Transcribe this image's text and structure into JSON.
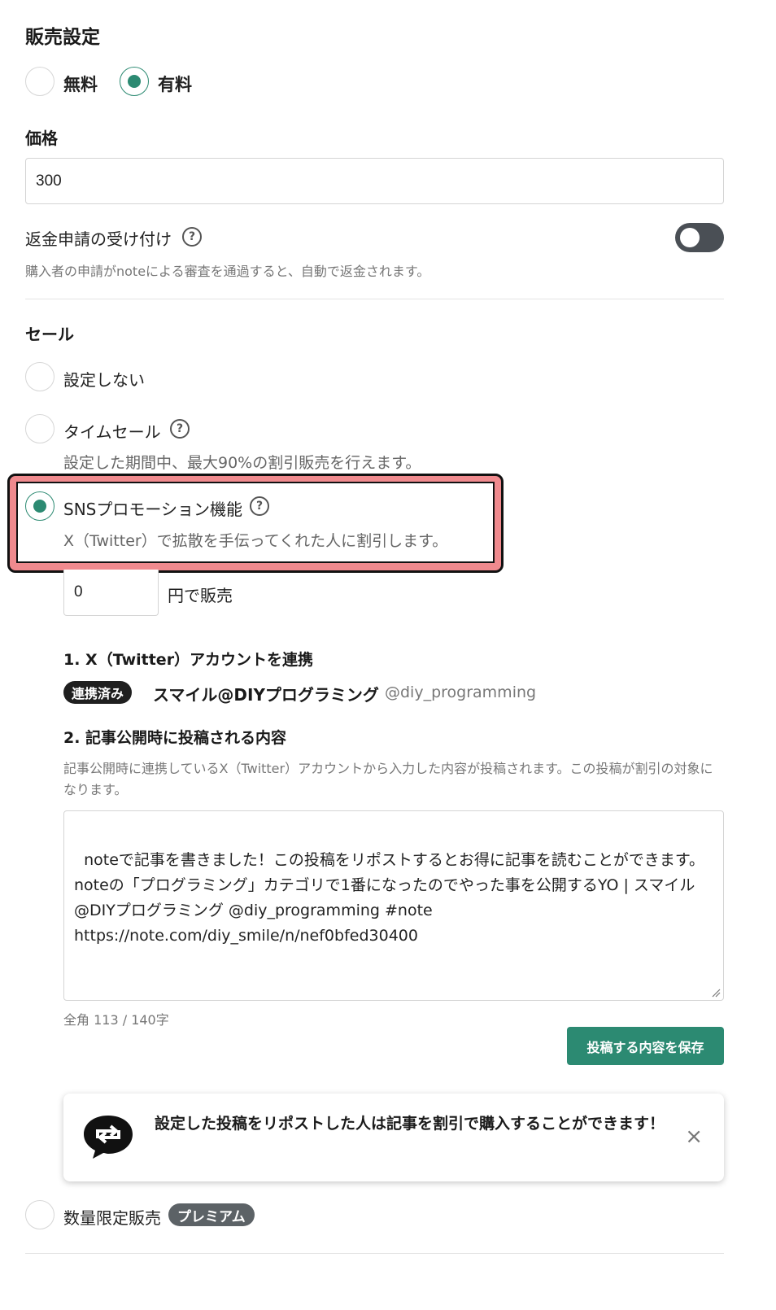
{
  "sales": {
    "title": "販売設定",
    "options": [
      {
        "label": "無料",
        "checked": false
      },
      {
        "label": "有料",
        "checked": true
      }
    ]
  },
  "price": {
    "label": "価格",
    "value": "300"
  },
  "refund": {
    "label": "返金申請の受け付け",
    "help_icon": "?",
    "enabled": false,
    "description": "購入者の申請がnoteによる審査を通過すると、自動で返金されます。"
  },
  "sale": {
    "title": "セール",
    "options": [
      {
        "label": "設定しない",
        "checked": false
      },
      {
        "label": "タイムセール",
        "checked": false,
        "help_icon": "?",
        "description": "設定した期間中、最大90%の割引販売を行えます。"
      },
      {
        "label": "SNSプロモーション機能",
        "checked": true,
        "help_icon": "?",
        "description": "X（Twitter）で拡散を手伝ってくれた人に割引します。"
      }
    ]
  },
  "promo": {
    "amount_value": "0",
    "amount_suffix": "円で販売",
    "step1_title": "1. X（Twitter）アカウントを連携",
    "linked_badge": "連携済み",
    "account_name": "スマイル@DIYプログラミング",
    "account_handle": "@diy_programming",
    "step2_title": "2. 記事公開時に投稿される内容",
    "step2_description": "記事公開時に連携しているX（Twitter）アカウントから入力した内容が投稿されます。この投稿が割引の対象になります。",
    "post_text": "noteで記事を書きました！この投稿をリポストするとお得に記事を読むことができます。\nnoteの「プログラミング」カテゴリで1番になったのでやった事を公開するYO | スマイル@DIYプログラミング @diy_programming #note\nhttps://note.com/diy_smile/n/nef0bfed30400",
    "char_count": "全角 113 / 140字",
    "save_label": "投稿する内容を保存",
    "info_card_text": "設定した投稿をリポストした人は記事を割引で購入することができます！",
    "close_glyph": "×"
  },
  "limited": {
    "label": "数量限定販売",
    "badge": "プレミアム"
  },
  "colors": {
    "accent": "#2c8a72",
    "highlight": "#f08a8e"
  }
}
